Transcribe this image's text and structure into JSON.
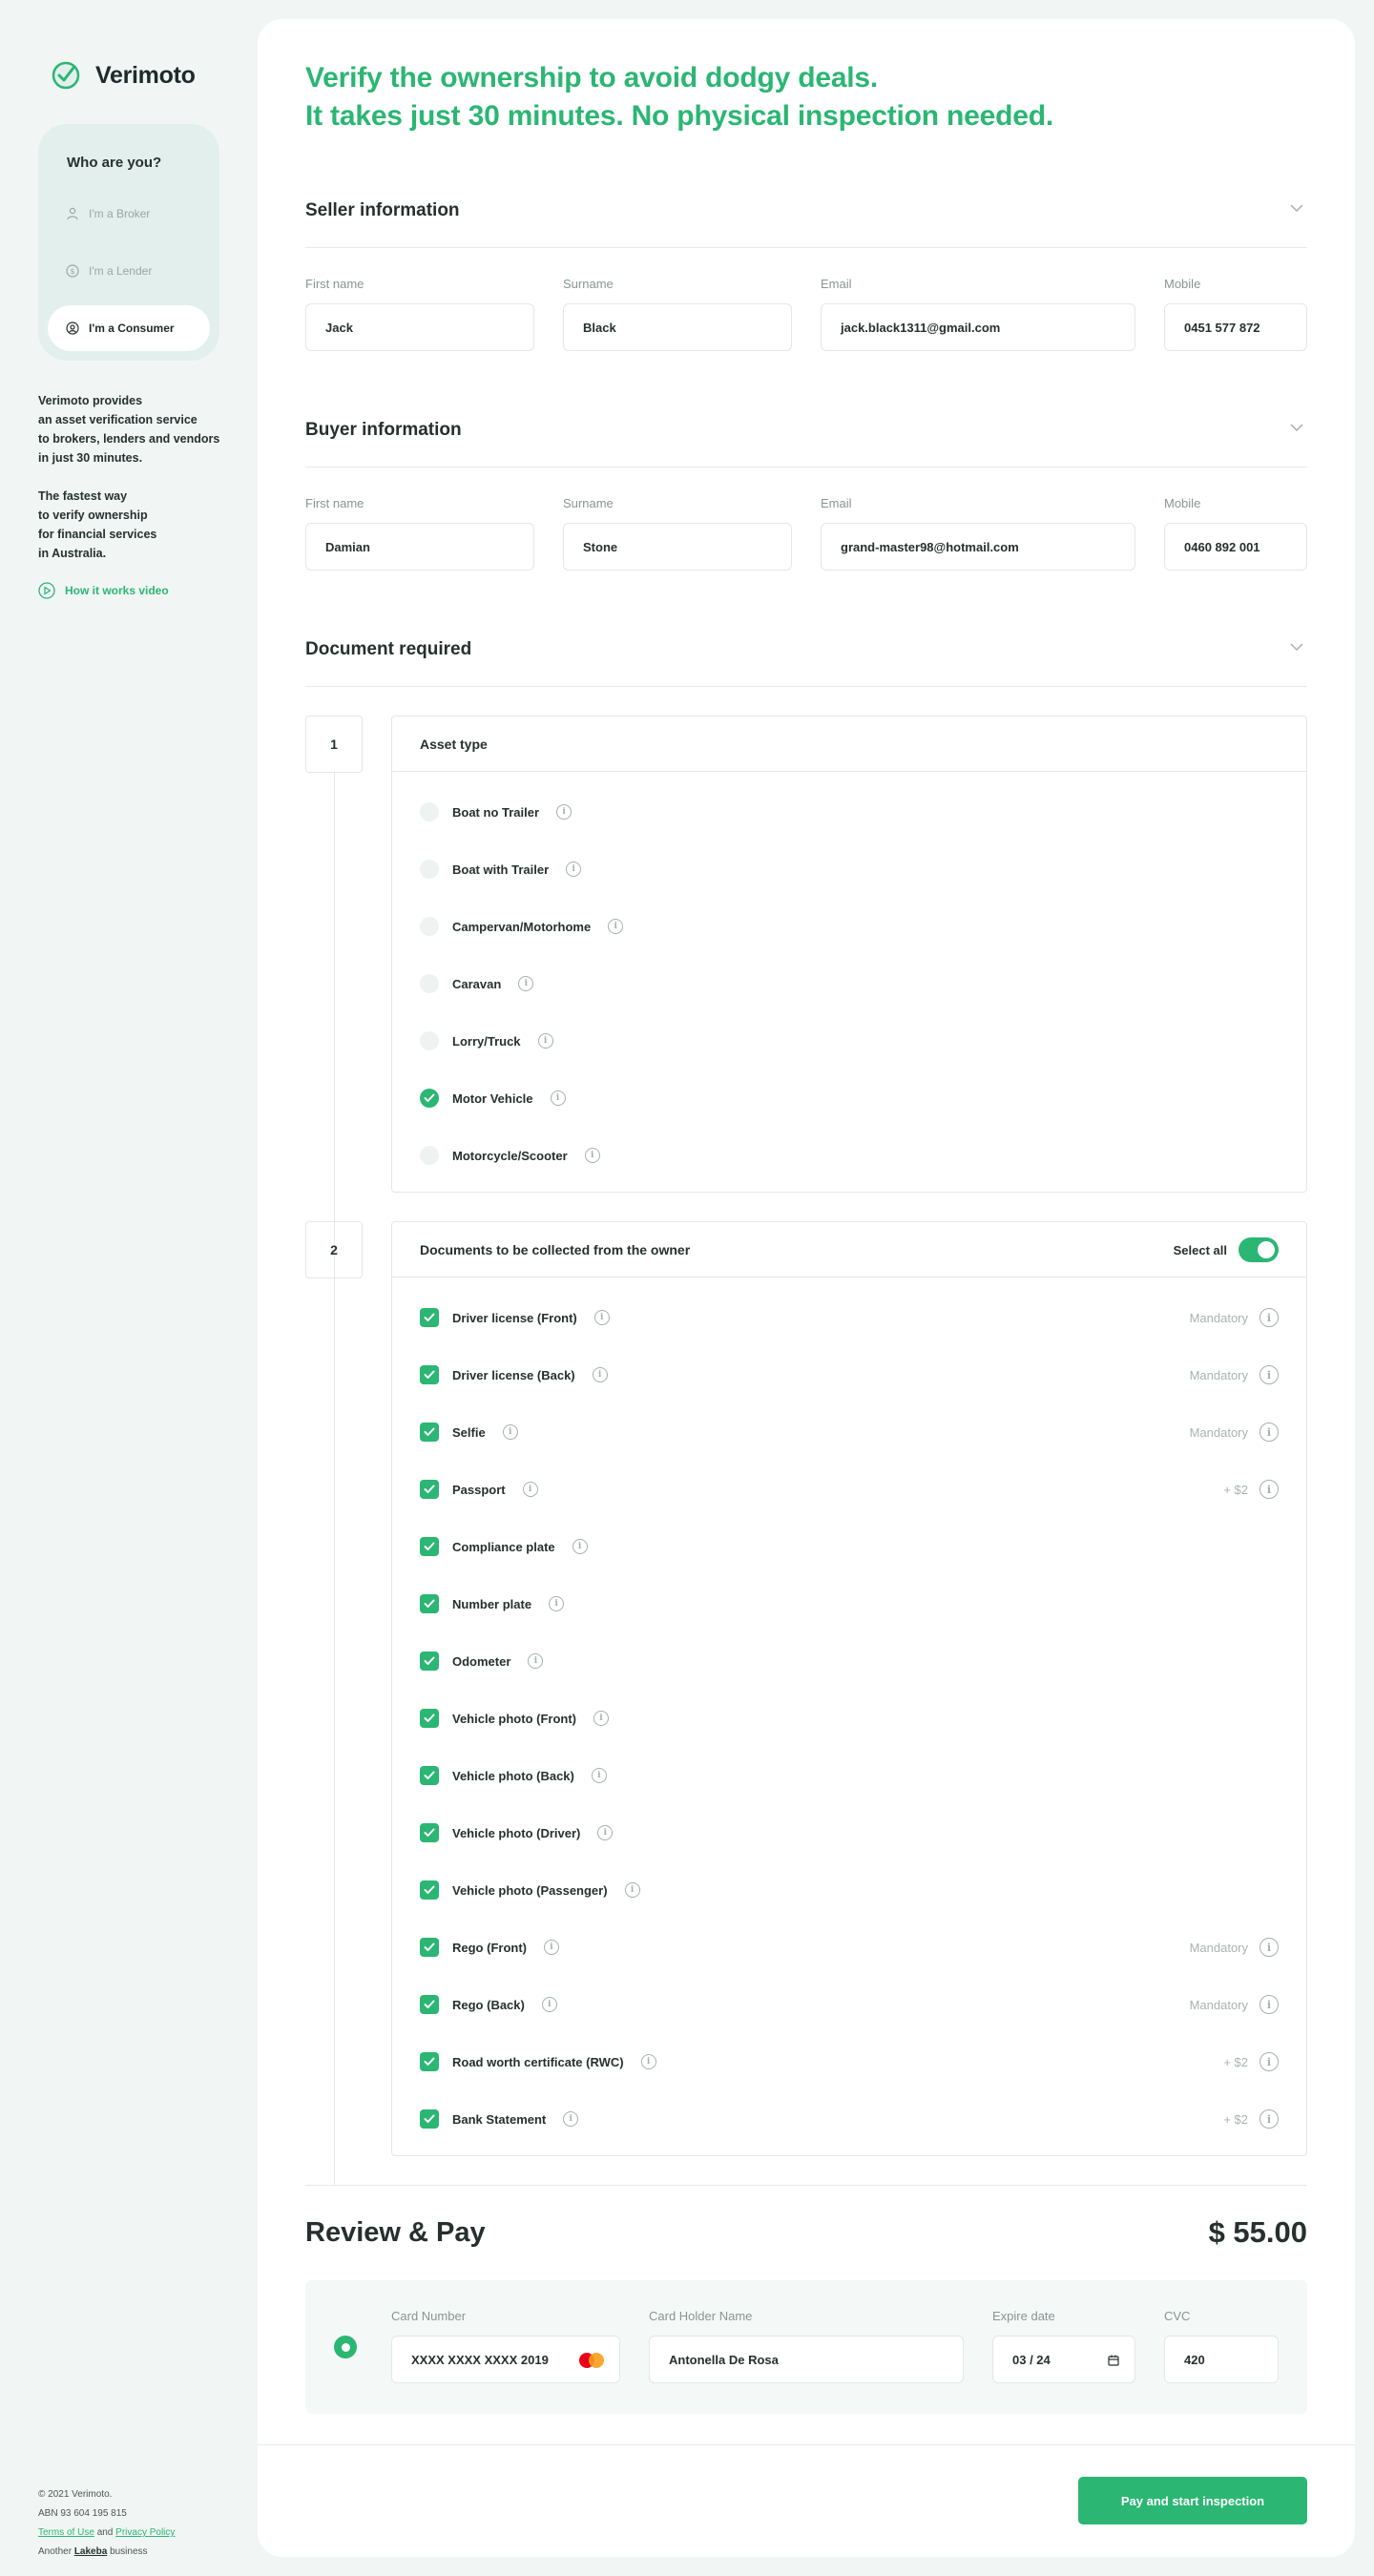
{
  "brand": {
    "name": "Verimoto",
    "accent": "#2bb673"
  },
  "sidebar": {
    "role_title": "Who are you?",
    "roles": [
      {
        "label": "I'm a Broker",
        "icon": "broker-icon"
      },
      {
        "label": "I'm a Lender",
        "icon": "dollar-icon"
      },
      {
        "label": "I'm a Consumer",
        "icon": "user-icon",
        "active": true
      }
    ],
    "about": [
      "Verimoto provides",
      "an asset verification service",
      "to brokers, lenders and vendors",
      "in just 30 minutes."
    ],
    "tagline": [
      "The fastest way",
      "to verify ownership",
      "for financial services",
      "in Australia."
    ],
    "video_link": "How it works video"
  },
  "footer": {
    "copyright": "© 2021 Verimoto.",
    "abn": "ABN 93 604 195 815",
    "terms": "Terms of Use",
    "and": "and",
    "privacy": "Privacy Policy",
    "another": "Another",
    "parent": "Lakeba",
    "business": "business"
  },
  "headline": [
    "Verify the ownership to avoid dodgy deals.",
    "It takes just 30 minutes. No physical inspection needed."
  ],
  "seller": {
    "title": "Seller information",
    "first_name": {
      "label": "First name",
      "value": "Jack"
    },
    "surname": {
      "label": "Surname",
      "value": "Black"
    },
    "email": {
      "label": "Email",
      "value": "jack.black1311@gmail.com"
    },
    "mobile": {
      "label": "Mobile",
      "value": "0451 577 872"
    }
  },
  "buyer": {
    "title": "Buyer information",
    "first_name": {
      "label": "First name",
      "value": "Damian"
    },
    "surname": {
      "label": "Surname",
      "value": "Stone"
    },
    "email": {
      "label": "Email",
      "value": "grand-master98@hotmail.com"
    },
    "mobile": {
      "label": "Mobile",
      "value": "0460 892 001"
    }
  },
  "documents": {
    "title": "Document required",
    "step1": {
      "number": "1",
      "title": "Asset type",
      "options": [
        {
          "label": "Boat no Trailer",
          "selected": false
        },
        {
          "label": "Boat with Trailer",
          "selected": false
        },
        {
          "label": "Campervan/Motorhome",
          "selected": false
        },
        {
          "label": "Caravan",
          "selected": false
        },
        {
          "label": "Lorry/Truck",
          "selected": false
        },
        {
          "label": "Motor Vehicle",
          "selected": true
        },
        {
          "label": "Motorcycle/Scooter",
          "selected": false
        }
      ]
    },
    "step2": {
      "number": "2",
      "title": "Documents to be collected from the owner",
      "select_all": "Select all",
      "items": [
        {
          "label": "Driver license (Front)",
          "note": "Mandatory"
        },
        {
          "label": "Driver license (Back)",
          "note": "Mandatory"
        },
        {
          "label": "Selfie",
          "note": "Mandatory"
        },
        {
          "label": "Passport",
          "note": "+ $2"
        },
        {
          "label": "Compliance plate",
          "note": ""
        },
        {
          "label": "Number plate",
          "note": ""
        },
        {
          "label": "Odometer",
          "note": ""
        },
        {
          "label": "Vehicle photo (Front)",
          "note": ""
        },
        {
          "label": "Vehicle photo (Back)",
          "note": ""
        },
        {
          "label": "Vehicle photo (Driver)",
          "note": ""
        },
        {
          "label": "Vehicle photo (Passenger)",
          "note": ""
        },
        {
          "label": "Rego (Front)",
          "note": "Mandatory"
        },
        {
          "label": "Rego (Back)",
          "note": "Mandatory"
        },
        {
          "label": "Road worth certificate (RWC)",
          "note": "+ $2"
        },
        {
          "label": "Bank Statement",
          "note": "+ $2"
        }
      ]
    }
  },
  "review": {
    "title": "Review & Pay",
    "price": "$ 55.00",
    "card_number": {
      "label": "Card Number",
      "value": "XXXX XXXX XXXX 2019"
    },
    "holder": {
      "label": "Card Holder Name",
      "value": "Antonella De Rosa"
    },
    "expiry": {
      "label": "Expire date",
      "value": "03 / 24"
    },
    "cvc": {
      "label": "CVC",
      "value": "420"
    },
    "pay_button": "Pay and start inspection"
  }
}
